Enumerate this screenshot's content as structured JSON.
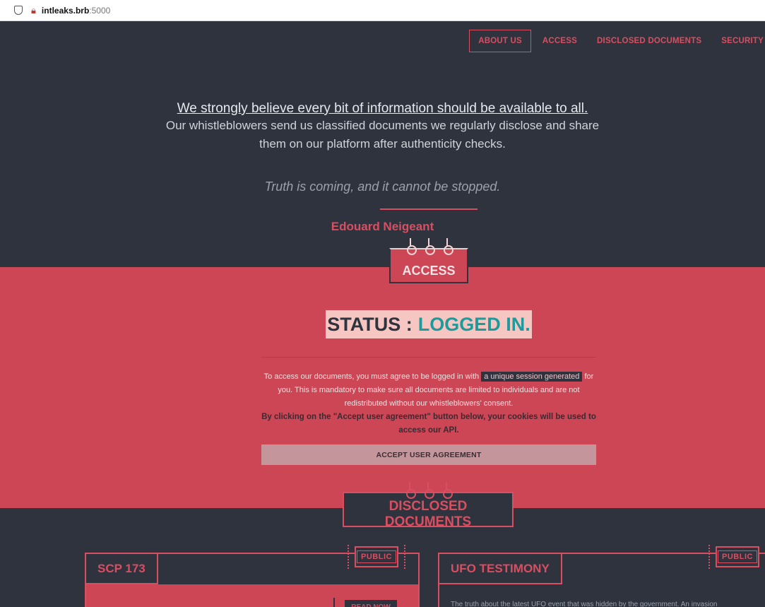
{
  "browser": {
    "host": "intleaks.brb",
    "port": ":5000"
  },
  "nav": {
    "items": [
      {
        "label": "ABOUT US",
        "active": true
      },
      {
        "label": "ACCESS",
        "active": false
      },
      {
        "label": "DISCLOSED DOCUMENTS",
        "active": false
      },
      {
        "label": "SECURITY",
        "active": false
      }
    ]
  },
  "hero": {
    "lead": "We strongly believe every bit of information should be available to all.",
    "sub_line1": "Our whistleblowers send us classified documents we regularly disclose and share",
    "sub_line2": "them on our platform after authenticity checks.",
    "quote": "Truth is coming, and it cannot be stopped.",
    "author": "Edouard Neigeant"
  },
  "access": {
    "tab_label": "ACCESS",
    "status_label": "STATUS :",
    "status_value": "LOGGED IN.",
    "info_pre": "To access our documents, you must agree to be logged in with",
    "info_highlight": "a unique session generated",
    "info_post": "for you. This is mandatory to make sure all documents are limited to individuals and are not redistributed without our whistleblowers' consent.",
    "info_bold": "By clicking on the \"Accept user agreement\" button below, your cookies will be used to access our API.",
    "accept_button": "ACCEPT USER AGREEMENT"
  },
  "documents": {
    "tab_label": "DISCLOSED DOCUMENTS",
    "cards": [
      {
        "title": "SCP 173",
        "badge": "PUBLIC",
        "action": "READ NOW"
      },
      {
        "title": "UFO TESTIMONY",
        "badge": "PUBLIC",
        "description": "The truth about the latest UFO event that was hidden by the government. An invasion"
      }
    ]
  },
  "colors": {
    "dark": "#2e333d",
    "accent": "#d94f61",
    "access_bg": "#cc4656",
    "status_ok": "#1f9a9a"
  }
}
